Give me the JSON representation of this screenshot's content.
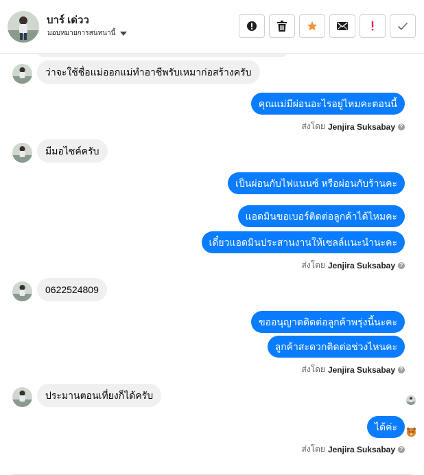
{
  "header": {
    "name": "บาร์ เด่วว",
    "assign_label": "มอบหมายการสนทนานี้"
  },
  "actions": [
    {
      "name": "alert-icon",
      "color": "#1c1e21"
    },
    {
      "name": "trash-icon",
      "color": "#1c1e21"
    },
    {
      "name": "star-icon",
      "color": "#f7923a"
    },
    {
      "name": "envelope-icon",
      "color": "#1c1e21"
    },
    {
      "name": "exclamation-icon",
      "color": "#e41e3f"
    },
    {
      "name": "check-icon",
      "color": "#606770"
    }
  ],
  "messages": [
    {
      "type": "in",
      "text": "ว่าจะใช้ชื่อแม่ออกแม่ทำอาชีพรับเหมาก่อสร้างครับ"
    },
    {
      "type": "out",
      "text": "คุณแม่มีผ่อนอะไรอยู่ไหมคะตอนนี้"
    },
    {
      "type": "in",
      "text": "มีมอไซค์ครับ"
    },
    {
      "type": "out",
      "text": "เป็นผ่อนกับไฟแนนซ์ หรือผ่อนกับร้านคะ"
    },
    {
      "type": "out",
      "text": "แอดมินขอเบอร์ติดต่อลูกค้าได้ไหมคะ"
    },
    {
      "type": "out",
      "text": "เดี๋ยวแอดมินประสานงานให้เซลล์แนะนำนะคะ"
    },
    {
      "type": "in",
      "text": "0622524809"
    },
    {
      "type": "out",
      "text": "ขออนุญาตติดต่อลูกค้าพรุ่งนี้นะคะ"
    },
    {
      "type": "out",
      "text": "ลูกค้าสะดวกติดต่อช่วงไหนคะ"
    },
    {
      "type": "in",
      "text": "ประมานตอนเที่ยงก็ได้ครับ"
    },
    {
      "type": "out",
      "text": "ได้ค่ะ"
    }
  ],
  "sent_by": {
    "prefix": "ส่งโดย",
    "agent": "Jenjira Suksabay",
    "info": "?"
  },
  "colors": {
    "outgoing_bubble": "#0a7cff",
    "incoming_bubble": "#f0f0f0"
  }
}
